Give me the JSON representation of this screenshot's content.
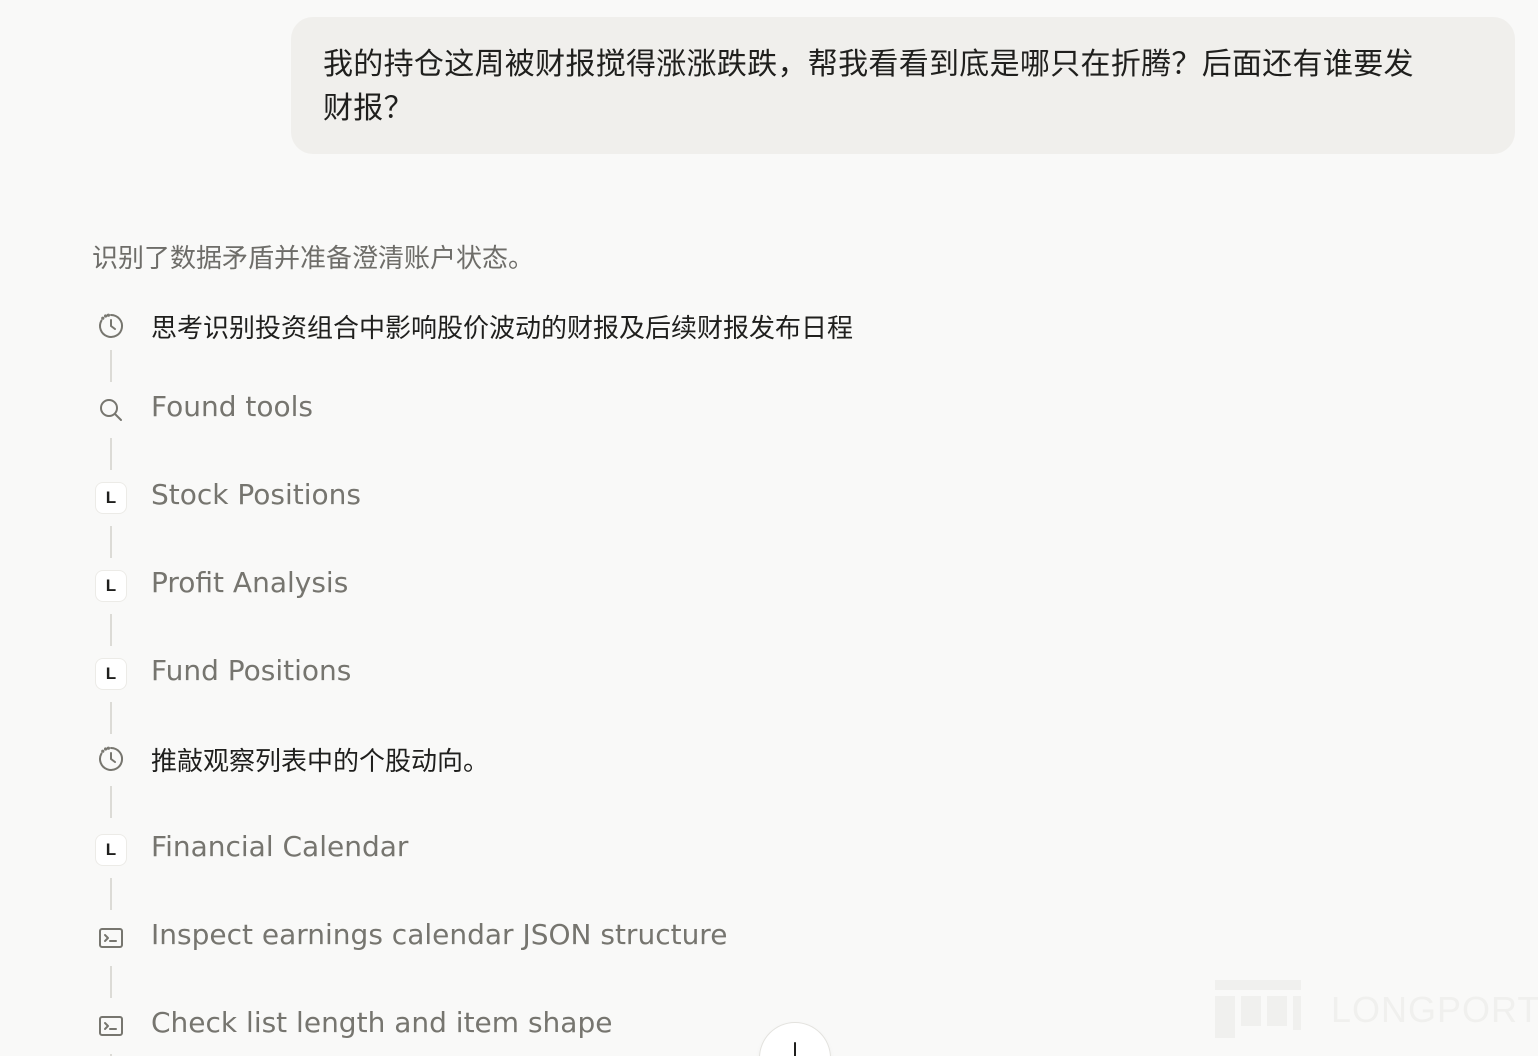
{
  "user_message": {
    "line1": "我的持仓这周被财报搅得涨涨跌跌，帮我看看到底是哪只在折腾？后面还有谁要发",
    "line2": "财报？"
  },
  "assistant": {
    "status": "识别了数据矛盾并准备澄清账户状态。",
    "steps": [
      {
        "kind": "thought",
        "icon": "clock-history-icon",
        "label": "思考识别投资组合中影响股价波动的财报及后续财报发布日程"
      },
      {
        "kind": "tool",
        "icon": "search-icon",
        "label": "Found tools"
      },
      {
        "kind": "tool",
        "icon": "longport-l-icon",
        "badge": "L",
        "label": "Stock Positions"
      },
      {
        "kind": "tool",
        "icon": "longport-l-icon",
        "badge": "L",
        "label": "Profit Analysis"
      },
      {
        "kind": "tool",
        "icon": "longport-l-icon",
        "badge": "L",
        "label": "Fund Positions"
      },
      {
        "kind": "thought",
        "icon": "clock-history-icon",
        "label": "推敲观察列表中的个股动向。"
      },
      {
        "kind": "tool",
        "icon": "longport-l-icon",
        "badge": "L",
        "label": "Financial Calendar"
      },
      {
        "kind": "tool",
        "icon": "terminal-icon",
        "label": "Inspect earnings calendar JSON structure"
      },
      {
        "kind": "tool",
        "icon": "terminal-icon",
        "label": "Check list length and item shape"
      }
    ]
  },
  "watermark": {
    "text": "LONGPORT"
  },
  "colors": {
    "background": "#f9f9f8",
    "bubble": "#f0efec",
    "muted_text": "#76756f",
    "primary_text": "#1f1f1d",
    "connector": "#dcdbd6"
  }
}
